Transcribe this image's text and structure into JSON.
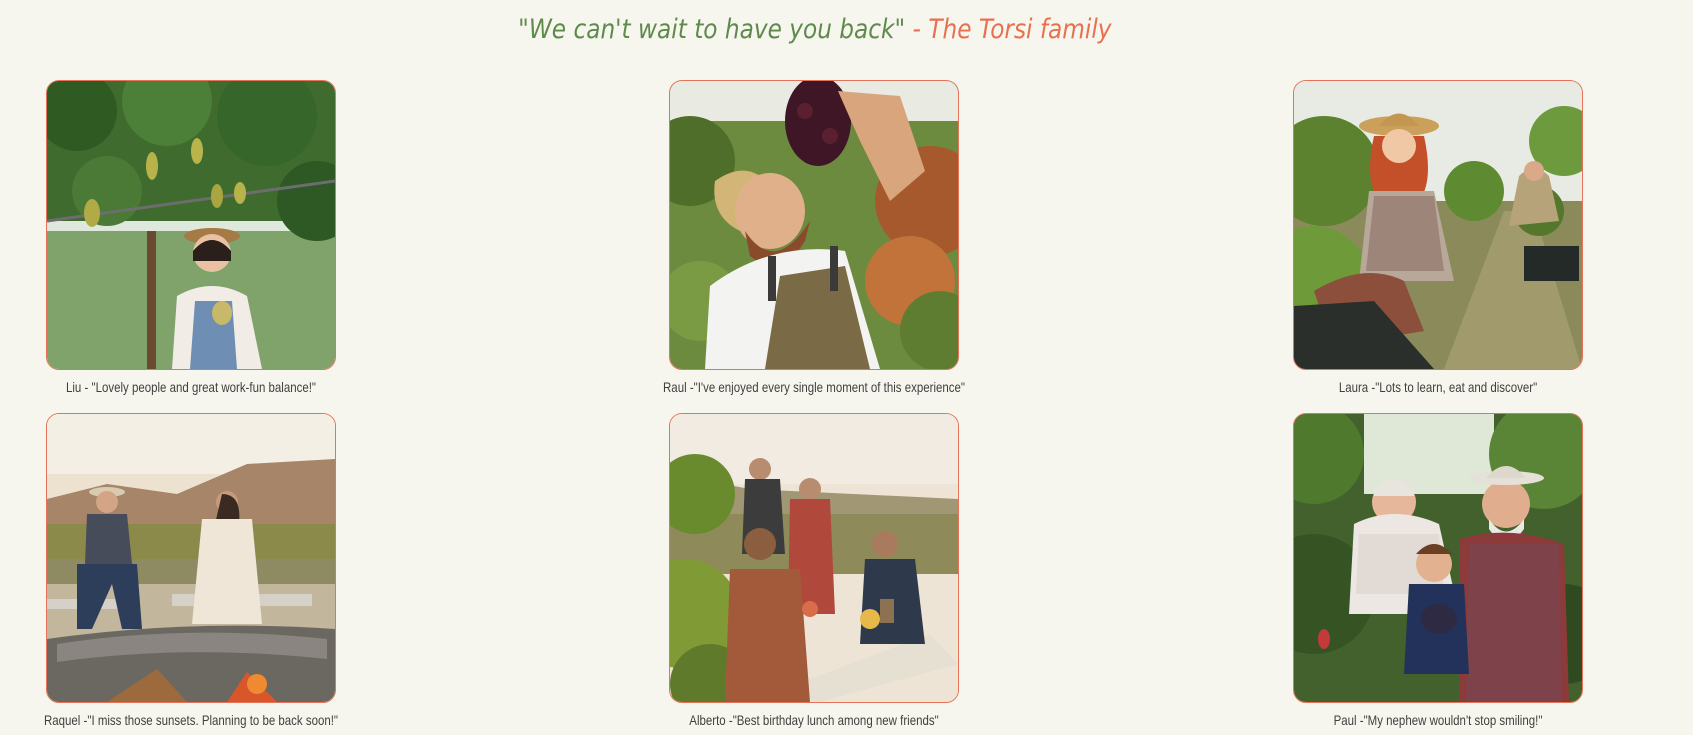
{
  "header": {
    "quote": "\"We can't wait to have you back\"",
    "separator": " - ",
    "author": "The Torsi family"
  },
  "colors": {
    "background": "#f7f6ee",
    "quote_green": "#5e8a4c",
    "accent_coral": "#e8704f",
    "caption_text": "#3f3f3f",
    "card_border": "#e4735a"
  },
  "testimonials": [
    {
      "caption": "Liu - \"Lovely people and great work-fun balance!\"",
      "photo": "woman-under-grape-vines-photo"
    },
    {
      "caption": "Raul -\"I've enjoyed every single moment of this experience\"",
      "photo": "man-eating-grapes-photo"
    },
    {
      "caption": "Laura -\"Lots to learn, eat and discover\"",
      "photo": "woman-harvesting-grapes-photo"
    },
    {
      "caption": "Raquel -\"I miss those sunsets. Planning to be back soon!\"",
      "photo": "women-at-sunset-firepit-photo"
    },
    {
      "caption": "Alberto -\"Best birthday lunch among new friends\"",
      "photo": "friends-toasting-outdoor-lunch-photo"
    },
    {
      "caption": "Paul -\"My nephew wouldn't stop smiling!\"",
      "photo": "family-picking-grapes-photo"
    }
  ]
}
